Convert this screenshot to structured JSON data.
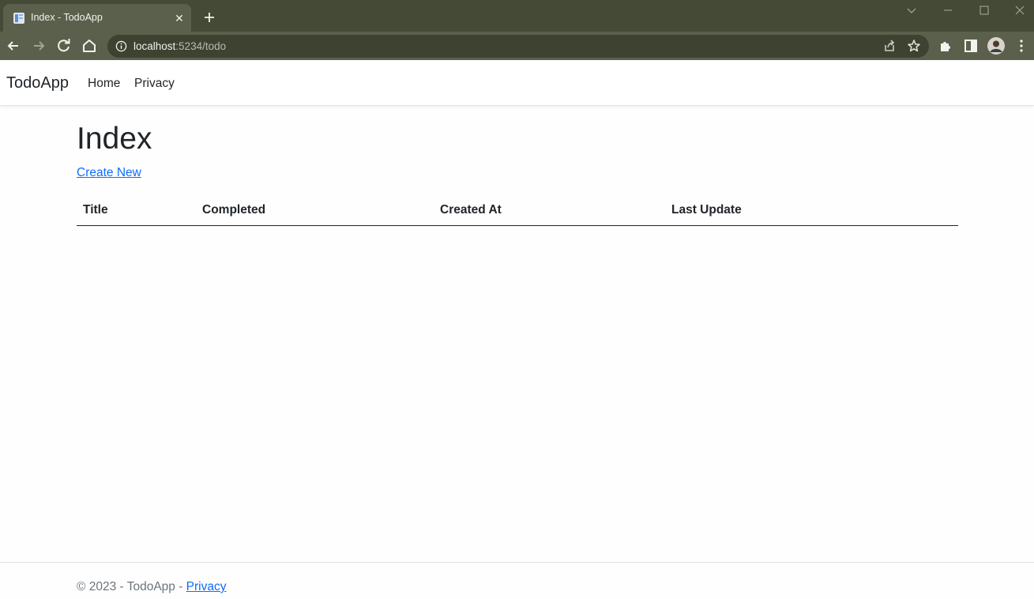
{
  "browser": {
    "tab_title": "Index - TodoApp",
    "tab_close": "✕",
    "url_host": "localhost",
    "url_rest": ":5234/todo"
  },
  "navbar": {
    "brand": "TodoApp",
    "links": [
      "Home",
      "Privacy"
    ]
  },
  "main": {
    "heading": "Index",
    "create_link": "Create New",
    "table": {
      "columns": [
        "Title",
        "Completed",
        "Created At",
        "Last Update"
      ],
      "rows": []
    }
  },
  "footer": {
    "text": "© 2023 - TodoApp - ",
    "link": "Privacy"
  },
  "colors": {
    "chrome_frame": "#454a37",
    "chrome_toolbar": "#5a604b",
    "link": "#0d6efd",
    "text": "#212529",
    "muted": "#6c757d"
  }
}
